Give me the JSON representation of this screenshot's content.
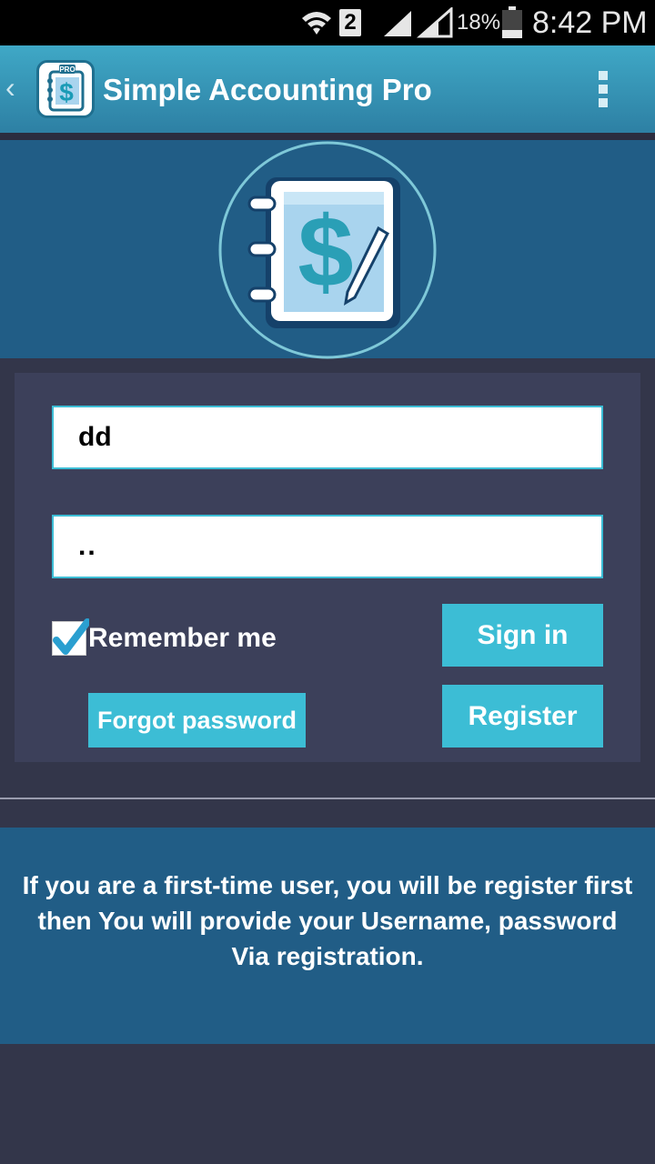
{
  "status_bar": {
    "sim_slot": "2",
    "battery_percent": "18%",
    "clock": "8:42 PM",
    "icons": [
      "wifi-icon",
      "signal-icon",
      "battery-icon"
    ]
  },
  "action_bar": {
    "title": "Simple Accounting Pro",
    "app_icon_badge": "PRO"
  },
  "login": {
    "username_value": "dd",
    "password_value": "..",
    "remember_label": "Remember me",
    "remember_checked": true,
    "sign_in_label": "Sign in",
    "register_label": "Register",
    "forgot_label": "Forgot password"
  },
  "info": {
    "message": "If you are a first-time user, you will be register first then You will provide your Username, password Via registration."
  },
  "colors": {
    "accent": "#3cbdd5",
    "header": "#215d86",
    "panel": "#3c405a",
    "background": "#33364a"
  }
}
